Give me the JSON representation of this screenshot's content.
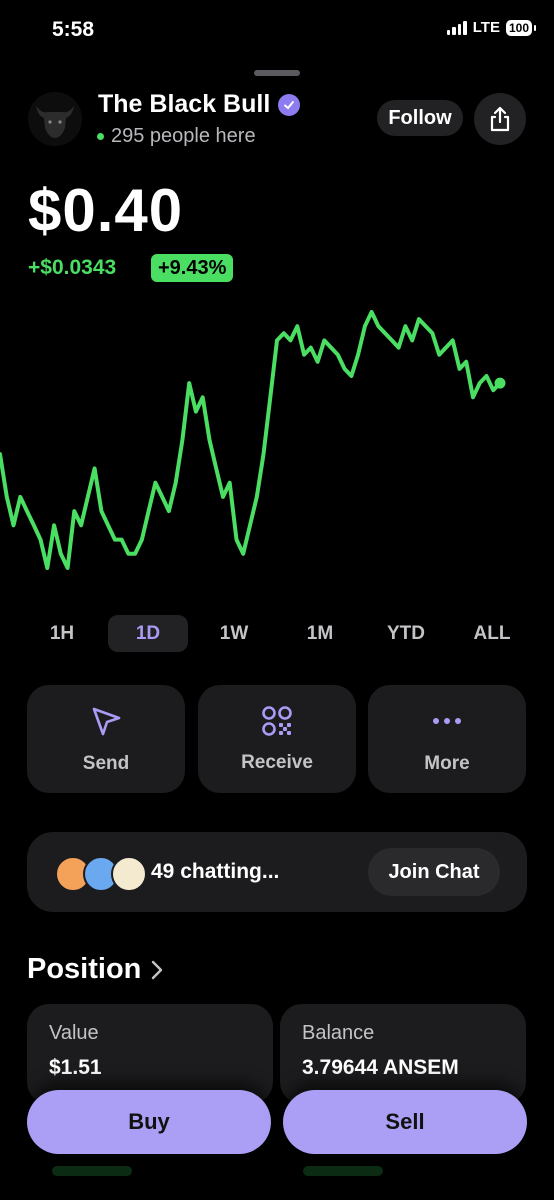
{
  "status_bar": {
    "time": "5:58",
    "network": "LTE",
    "battery": "100"
  },
  "token": {
    "name": "The Black Bull",
    "viewers": "295 people here"
  },
  "header": {
    "follow_label": "Follow"
  },
  "price": {
    "value": "$0.40",
    "change_abs": "+$0.0343",
    "change_pct": "+9.43%"
  },
  "timeframes": [
    "1H",
    "1D",
    "1W",
    "1M",
    "YTD",
    "ALL"
  ],
  "selected_timeframe": "1D",
  "actions": [
    {
      "label": "Send",
      "icon": "paper-plane-icon"
    },
    {
      "label": "Receive",
      "icon": "qr-code-icon"
    },
    {
      "label": "More",
      "icon": "ellipsis-icon"
    }
  ],
  "chat": {
    "count_text": "49 chatting...",
    "join_label": "Join Chat"
  },
  "position": {
    "title": "Position",
    "value_label": "Value",
    "value": "$1.51",
    "balance_label": "Balance",
    "balance": "3.79644 ANSEM"
  },
  "buttons": {
    "buy": "Buy",
    "sell": "Sell"
  },
  "colors": {
    "accent": "#aa9ff5",
    "positive": "#4ade62",
    "card": "#1c1c1e"
  },
  "chart_data": {
    "type": "line",
    "series": [
      {
        "values": [
          0.3,
          0.27,
          0.25,
          0.27,
          0.26,
          0.25,
          0.24,
          0.22,
          0.25,
          0.23,
          0.22,
          0.26,
          0.25,
          0.27,
          0.29,
          0.26,
          0.25,
          0.24,
          0.24,
          0.23,
          0.23,
          0.24,
          0.26,
          0.28,
          0.27,
          0.26,
          0.28,
          0.31,
          0.35,
          0.33,
          0.34,
          0.31,
          0.29,
          0.27,
          0.28,
          0.24,
          0.23,
          0.25,
          0.27,
          0.3,
          0.34,
          0.38,
          0.385,
          0.38,
          0.39,
          0.37,
          0.375,
          0.365,
          0.38,
          0.375,
          0.37,
          0.36,
          0.355,
          0.37,
          0.39,
          0.4,
          0.39,
          0.385,
          0.38,
          0.375,
          0.39,
          0.38,
          0.395,
          0.39,
          0.385,
          0.37,
          0.375,
          0.38,
          0.36,
          0.365,
          0.34,
          0.35,
          0.355,
          0.345,
          0.35
        ]
      }
    ]
  }
}
